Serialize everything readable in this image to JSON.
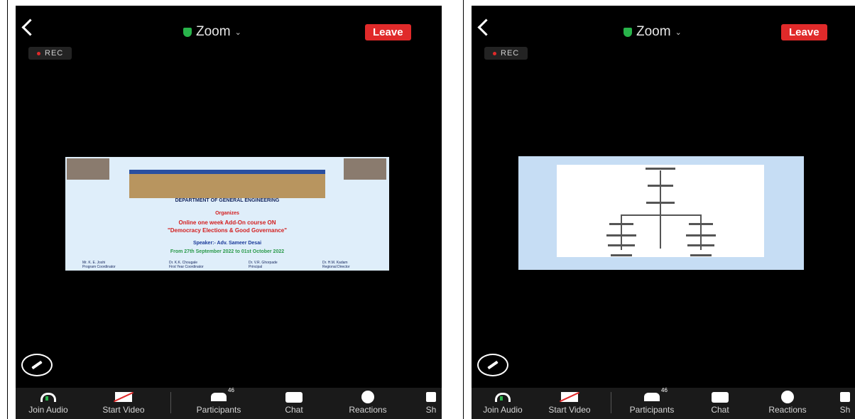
{
  "screens": [
    {
      "header": {
        "title": "Zoom",
        "leave_label": "Leave",
        "rec_label": "REC"
      },
      "slide": {
        "department": "DEPARTMENT OF GENERAL ENGINEERING",
        "organizes": "Organizes",
        "course_line1": "Online one week Add-On course ON",
        "course_line2": "\"Democracy Elections & Good Governance\"",
        "speaker": "Speaker:- Adv. Sameer Desai",
        "dates": "From 27th September 2022 to 01st October 2022",
        "people": [
          {
            "name": "Mr. K. E. Joshi",
            "role": "Program Coordinator"
          },
          {
            "name": "Dr. K.K. Chougale",
            "role": "First Year Coordinator"
          },
          {
            "name": "Dr. V.R. Ghorpade",
            "role": "Principal"
          },
          {
            "name": "Dr. H.M. Kadam",
            "role": "Regional Director"
          }
        ]
      },
      "toolbar": [
        {
          "label": "Join Audio",
          "icon": "headphones-icon"
        },
        {
          "label": "Start Video",
          "icon": "video-off-icon"
        },
        {
          "label": "Participants",
          "icon": "participants-icon"
        },
        {
          "label": "Chat",
          "icon": "chat-icon"
        },
        {
          "label": "Reactions",
          "icon": "reactions-icon"
        },
        {
          "label": "Sh",
          "icon": "share-icon"
        }
      ]
    },
    {
      "header": {
        "title": "Zoom",
        "leave_label": "Leave",
        "rec_label": "REC"
      },
      "toolbar": [
        {
          "label": "Join Audio",
          "icon": "headphones-icon"
        },
        {
          "label": "Start Video",
          "icon": "video-off-icon"
        },
        {
          "label": "Participants",
          "icon": "participants-icon"
        },
        {
          "label": "Chat",
          "icon": "chat-icon"
        },
        {
          "label": "Reactions",
          "icon": "reactions-icon"
        },
        {
          "label": "Sh",
          "icon": "share-icon"
        }
      ]
    }
  ],
  "colors": {
    "leave": "#e02a2a",
    "shield": "#28b34a",
    "title_red": "#d32020",
    "title_blue": "#1a3a9a"
  }
}
